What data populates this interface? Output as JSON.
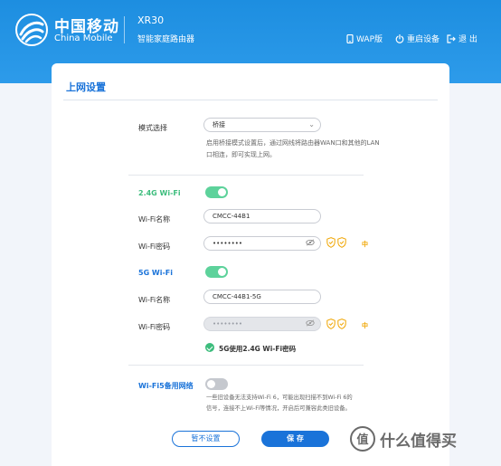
{
  "header": {
    "brand_cn": "中国移动",
    "brand_en": "China Mobile",
    "model": "XR30",
    "product": "智能家庭路由器",
    "nav": {
      "wap_label": "WAP版",
      "reboot_label": "重启设备",
      "logout_label": "退 出"
    }
  },
  "page": {
    "title": "上网设置",
    "mode": {
      "label": "模式选择",
      "value": "桥接",
      "description": [
        "启用桥接模式设置后，通过网线将路由器WAN口和其他的LAN",
        "口相连，即可实现上网。"
      ]
    },
    "wifi_24": {
      "section_label": "2.4G Wi-Fi",
      "enabled": true,
      "name_label": "Wi-Fi名称",
      "name_value": "CMCC-44B1",
      "password_label": "Wi-Fi密码",
      "password_value": "••••••••",
      "strength": "中"
    },
    "wifi_5": {
      "section_label": "5G Wi-Fi",
      "enabled": true,
      "name_label": "Wi-Fi名称",
      "name_value": "CMCC-44B1-5G",
      "password_label": "Wi-Fi密码",
      "password_value": "••••••••",
      "strength": "中",
      "same_password_label": "5G使用2.4G Wi-Fi密码",
      "same_password_checked": true
    },
    "backup": {
      "label": "Wi-Fi5备用网络",
      "enabled": false,
      "note": [
        "一些旧设备无法支持Wi-Fi 6，可能出现扫描不到Wi-Fi 6的",
        "信号，连接不上Wi-Fi等情况，开启后可兼容此类旧设备。"
      ]
    },
    "buttons": {
      "skip": "暂不设置",
      "save": "保 存"
    }
  },
  "watermark": {
    "symbol": "值",
    "text": "什么值得买"
  },
  "colors": {
    "header_blue": "#1d8ee0",
    "accent_blue": "#1a73d9",
    "toggle_green": "#5dd29b",
    "label_green": "#3dbd7d",
    "strength_orange": "#f0a500"
  }
}
